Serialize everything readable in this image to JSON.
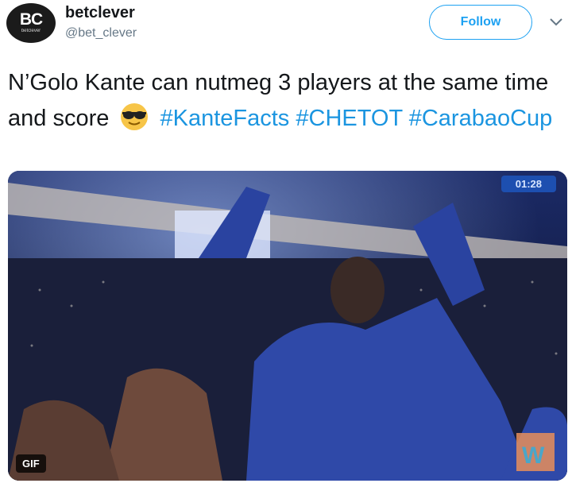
{
  "account": {
    "avatar_text": "BC",
    "avatar_subtext": "betclever",
    "name": "betclever",
    "handle": "@bet_clever"
  },
  "follow_button": {
    "label": "Follow"
  },
  "tweet": {
    "text_part1": "N’Golo Kante can nutmeg 3 players at the same time and score ",
    "emoji": "sunglasses-emoji",
    "hashtags": [
      "#KanteFacts",
      "#CHETOT",
      "#CarabaoCup"
    ]
  },
  "media": {
    "duration": "01:28",
    "badge": "GIF"
  },
  "colors": {
    "accent": "#1da1f2",
    "hashtag": "#1b95e0",
    "muted": "#657786"
  }
}
